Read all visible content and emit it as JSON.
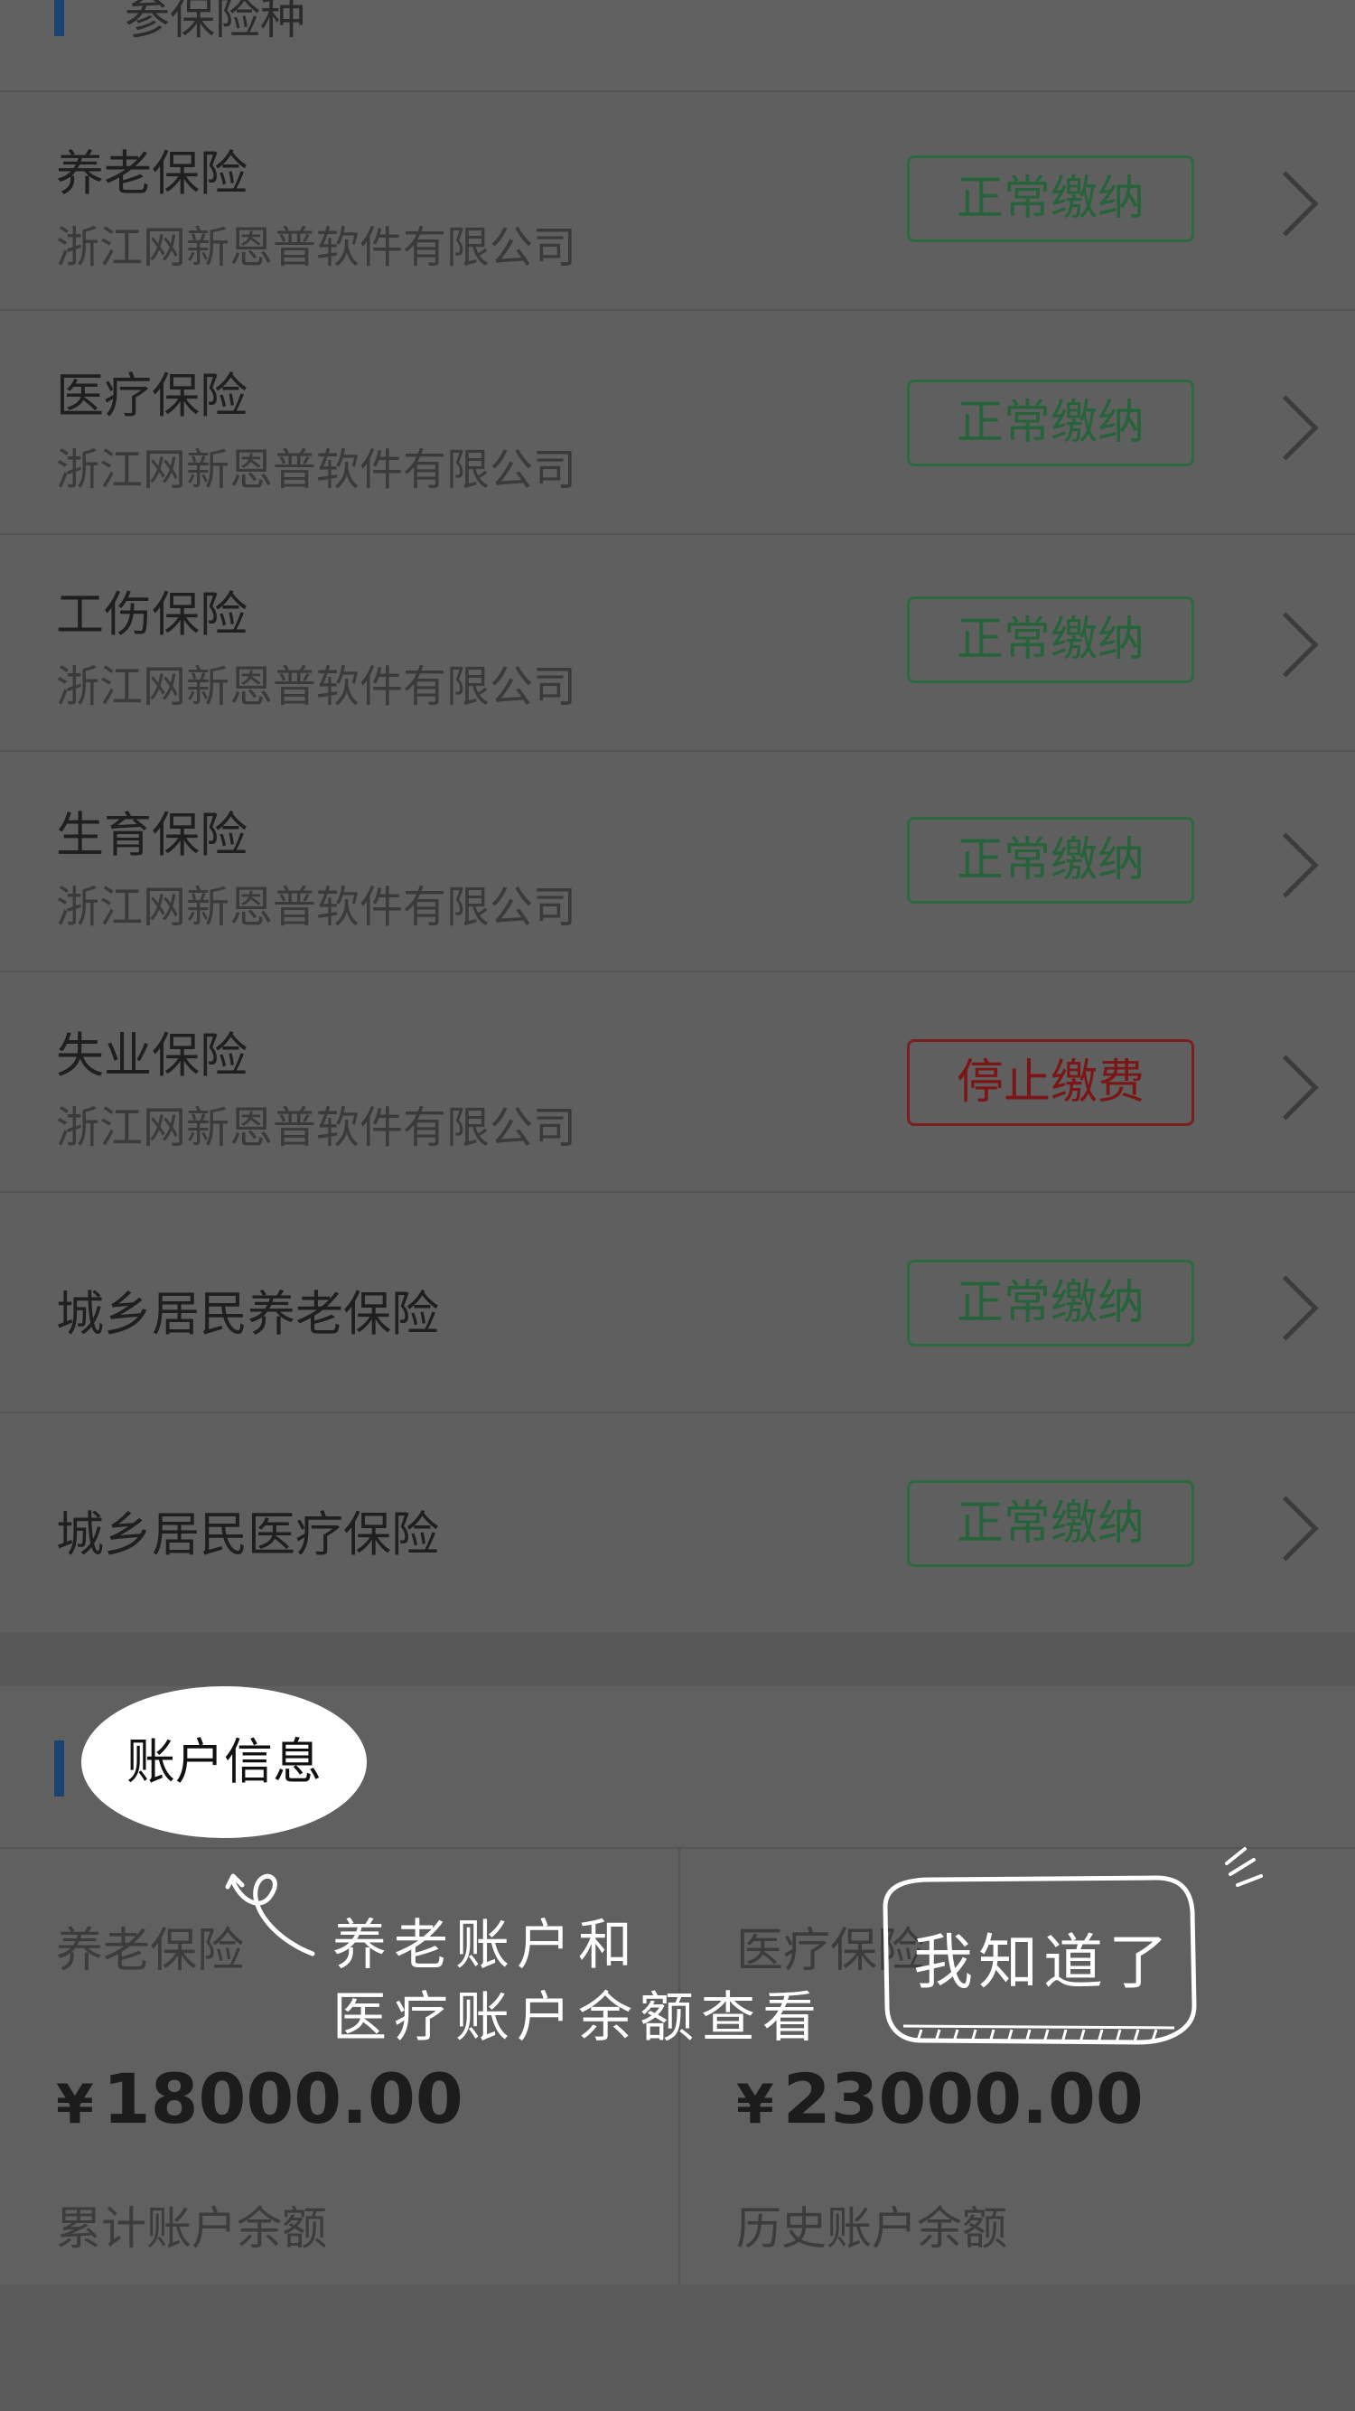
{
  "insurance_section": {
    "title": "参保险种"
  },
  "insurance_items": [
    {
      "name": "养老保险",
      "company": "浙江网新恩普软件有限公司",
      "status": "正常缴纳"
    },
    {
      "name": "医疗保险",
      "company": "浙江网新恩普软件有限公司",
      "status": "正常缴纳"
    },
    {
      "name": "工伤保险",
      "company": "浙江网新恩普软件有限公司",
      "status": "正常缴纳"
    },
    {
      "name": "生育保险",
      "company": "浙江网新恩普软件有限公司",
      "status": "正常缴纳"
    },
    {
      "name": "失业保险",
      "company": "浙江网新恩普软件有限公司",
      "status": "停止缴费"
    },
    {
      "name": "城乡居民养老保险",
      "status": "正常缴纳"
    },
    {
      "name": "城乡居民医疗保险",
      "status": "正常缴纳"
    }
  ],
  "account_section": {
    "title": "账户信息"
  },
  "accounts": [
    {
      "label": "养老保险",
      "currency": "¥",
      "amount": "18000.00",
      "sub": "累计账户余额"
    },
    {
      "label": "医疗保险",
      "currency": "¥",
      "amount": "23000.00",
      "sub": "历史账户余额"
    }
  ],
  "guide": {
    "hint_line1": "养老账户和",
    "hint_line2": "医疗账户余额查看",
    "dismiss_label": "我知道了"
  },
  "colors": {
    "normal_status": "#27633a",
    "stopped_status": "#7c1515",
    "section_bar": "#1c4270",
    "overlay_text": "#ffffff"
  }
}
